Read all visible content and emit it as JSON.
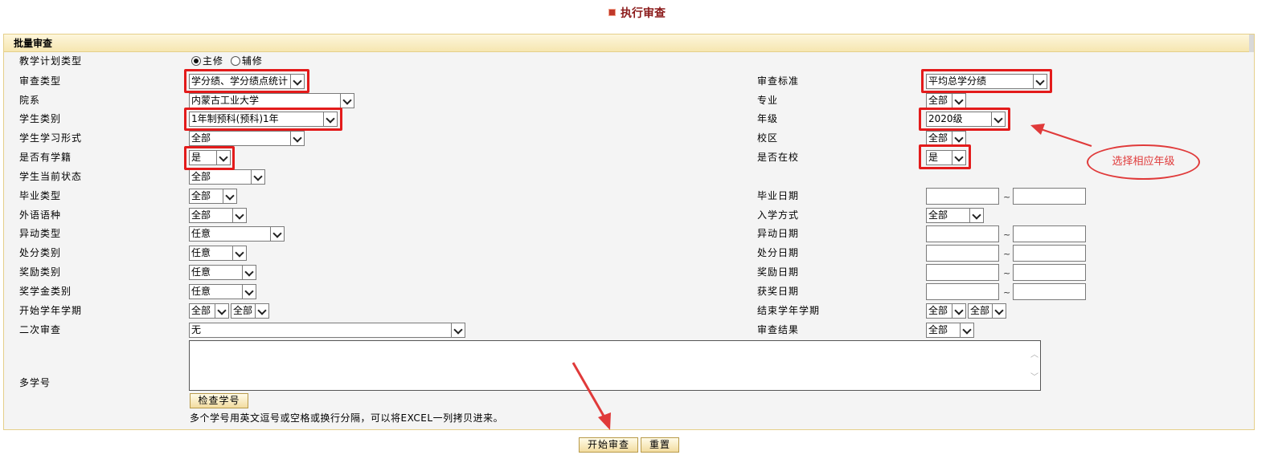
{
  "header": {
    "title": "执行审查"
  },
  "panel": {
    "title": "批量审查"
  },
  "fields": {
    "plan_type": {
      "label": "教学计划类型",
      "options": [
        "主修",
        "辅修"
      ],
      "selected": "主修"
    },
    "review_type": {
      "label": "审查类型",
      "value": "学分绩、学分绩点统计"
    },
    "review_standard": {
      "label": "审查标准",
      "value": "平均总学分绩"
    },
    "department": {
      "label": "院系",
      "value": "内蒙古工业大学"
    },
    "major": {
      "label": "专业",
      "value": "全部"
    },
    "student_category": {
      "label": "学生类别",
      "value": "1年制预科(预科)1年"
    },
    "grade": {
      "label": "年级",
      "value": "2020级"
    },
    "study_form": {
      "label": "学生学习形式",
      "value": "全部"
    },
    "campus": {
      "label": "校区",
      "value": "全部"
    },
    "has_status": {
      "label": "是否有学籍",
      "value": "是"
    },
    "in_school": {
      "label": "是否在校",
      "value": "是"
    },
    "current_state": {
      "label": "学生当前状态",
      "value": "全部"
    },
    "graduation_type": {
      "label": "毕业类型",
      "value": "全部"
    },
    "graduation_date": {
      "label": "毕业日期"
    },
    "language": {
      "label": "外语语种",
      "value": "全部"
    },
    "enroll_method": {
      "label": "入学方式",
      "value": "全部"
    },
    "change_type": {
      "label": "异动类型",
      "value": "任意"
    },
    "change_date": {
      "label": "异动日期"
    },
    "punish_type": {
      "label": "处分类别",
      "value": "任意"
    },
    "punish_date": {
      "label": "处分日期"
    },
    "reward_type": {
      "label": "奖励类别",
      "value": "任意"
    },
    "reward_date": {
      "label": "奖励日期"
    },
    "scholarship_type": {
      "label": "奖学金类别",
      "value": "任意"
    },
    "award_date": {
      "label": "获奖日期"
    },
    "start_term": {
      "label": "开始学年学期",
      "year": "全部",
      "term": "全部"
    },
    "end_term": {
      "label": "结束学年学期",
      "year": "全部",
      "term": "全部"
    },
    "second_review": {
      "label": "二次审查",
      "value": "无"
    },
    "review_result": {
      "label": "审查结果",
      "value": "全部"
    },
    "multi_ids": {
      "label": "多学号",
      "check_button": "检查学号",
      "note": "多个学号用英文逗号或空格或换行分隔，可以将EXCEL一列拷贝进来。"
    },
    "range_sep": "~"
  },
  "actions": {
    "start": "开始审查",
    "reset": "重置"
  },
  "annotation": {
    "text": "选择相应年级",
    "color": "#e03a3a"
  },
  "colors": {
    "title": "#8b1a1a",
    "highlight": "#e31b1b",
    "panel_bg": "#f4f4f4"
  }
}
